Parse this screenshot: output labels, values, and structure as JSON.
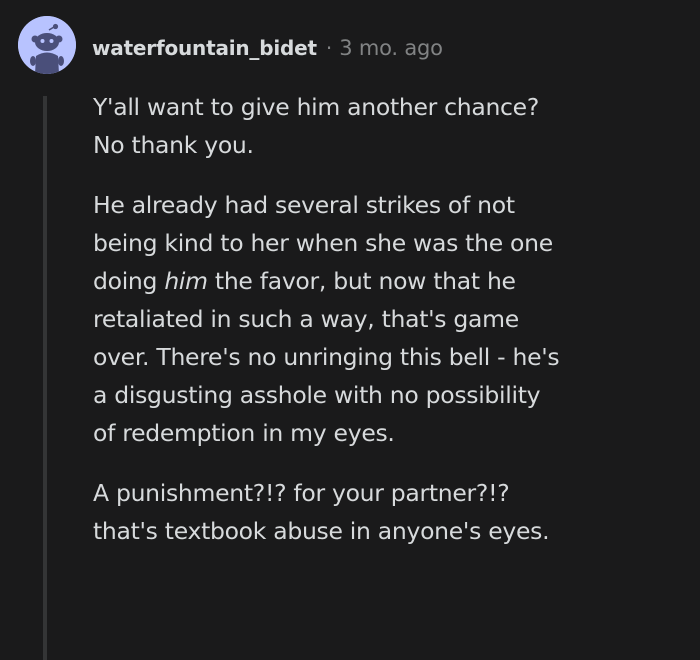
{
  "comment": {
    "author": "waterfountain_bidet",
    "separator": "·",
    "timestamp": "3 mo. ago",
    "avatar_icon": "reddit-snoo-avatar-icon",
    "colors": {
      "background": "#1a1a1b",
      "text": "#d7dadc",
      "meta": "#818384",
      "thread_line": "#343536",
      "avatar_bg": "#b8c3ff"
    },
    "paragraphs": [
      {
        "lines": [
          "Y'all want to give him another chance?",
          "No thank you."
        ]
      },
      {
        "lines": [
          "He already had several strikes of not",
          "being kind to her when she was the one"
        ],
        "line3_before": "doing ",
        "line3_emphasis": "him",
        "line3_after": " the favor, but now that he",
        "lines_rest": [
          "retaliated in such a way, that's game",
          "over. There's no unringing this bell - he's",
          "a disgusting asshole with no possibility",
          "of redemption in my eyes."
        ]
      },
      {
        "lines": [
          "A punishment?!? for your partner?!?",
          "that's textbook abuse in anyone's eyes."
        ]
      }
    ]
  }
}
